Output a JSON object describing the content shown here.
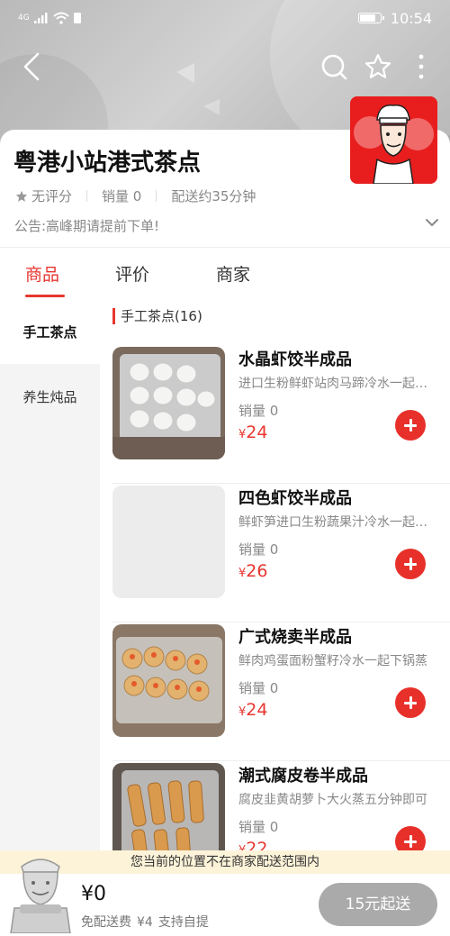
{
  "status_bar": {
    "signal": "4G",
    "time": "10:54",
    "battery_level": 0.8
  },
  "shop": {
    "name": "粤港小站港式茶点",
    "rating": "无评分",
    "sales": "销量 0",
    "delivery_time": "配送约35分钟",
    "notice": "公告:高峰期请提前下单!"
  },
  "tabs": [
    {
      "label": "商品",
      "active": true
    },
    {
      "label": "评价",
      "active": false
    },
    {
      "label": "商家",
      "active": false
    }
  ],
  "categories": [
    {
      "label": "手工茶点",
      "active": true
    },
    {
      "label": "养生炖品",
      "active": false
    }
  ],
  "category_title": "手工茶点(16)",
  "items": [
    {
      "name": "水晶虾饺半成品",
      "desc": "进口生粉鲜虾站肉马蹄冷水一起下锅",
      "sales": "销量 0",
      "currency": "¥",
      "price": "24",
      "image": "har-gow-photo"
    },
    {
      "name": "四色虾饺半成品",
      "desc": "鲜虾笋进口生粉蔬果汁冷水一起下锅",
      "sales": "销量 0",
      "currency": "¥",
      "price": "26",
      "image": "placeholder"
    },
    {
      "name": "广式烧卖半成品",
      "desc": "鲜肉鸡蛋面粉蟹籽冷水一起下锅蒸",
      "sales": "销量 0",
      "currency": "¥",
      "price": "24",
      "image": "siu-mai-photo"
    },
    {
      "name": "潮式腐皮卷半成品",
      "desc": "腐皮韭黄胡萝卜大火蒸五分钟即可",
      "sales": "销量 0",
      "currency": "¥",
      "price": "22",
      "image": "bean-curd-roll-photo"
    }
  ],
  "banner": "您当前的位置不在商家配送范围内",
  "cart": {
    "total": "¥0",
    "fee_label": "免配送费",
    "fee_original": "¥4",
    "pickup": "支持自提",
    "checkout_label": "15元起送"
  },
  "icons": {
    "back": "back-arrow-icon",
    "search": "search-icon",
    "favorite": "star-icon",
    "more": "more-vertical-icon"
  },
  "colors": {
    "accent": "#e8362f",
    "checkout_disabled": "#aaaaaa",
    "banner_bg": "#fdf3d9"
  }
}
